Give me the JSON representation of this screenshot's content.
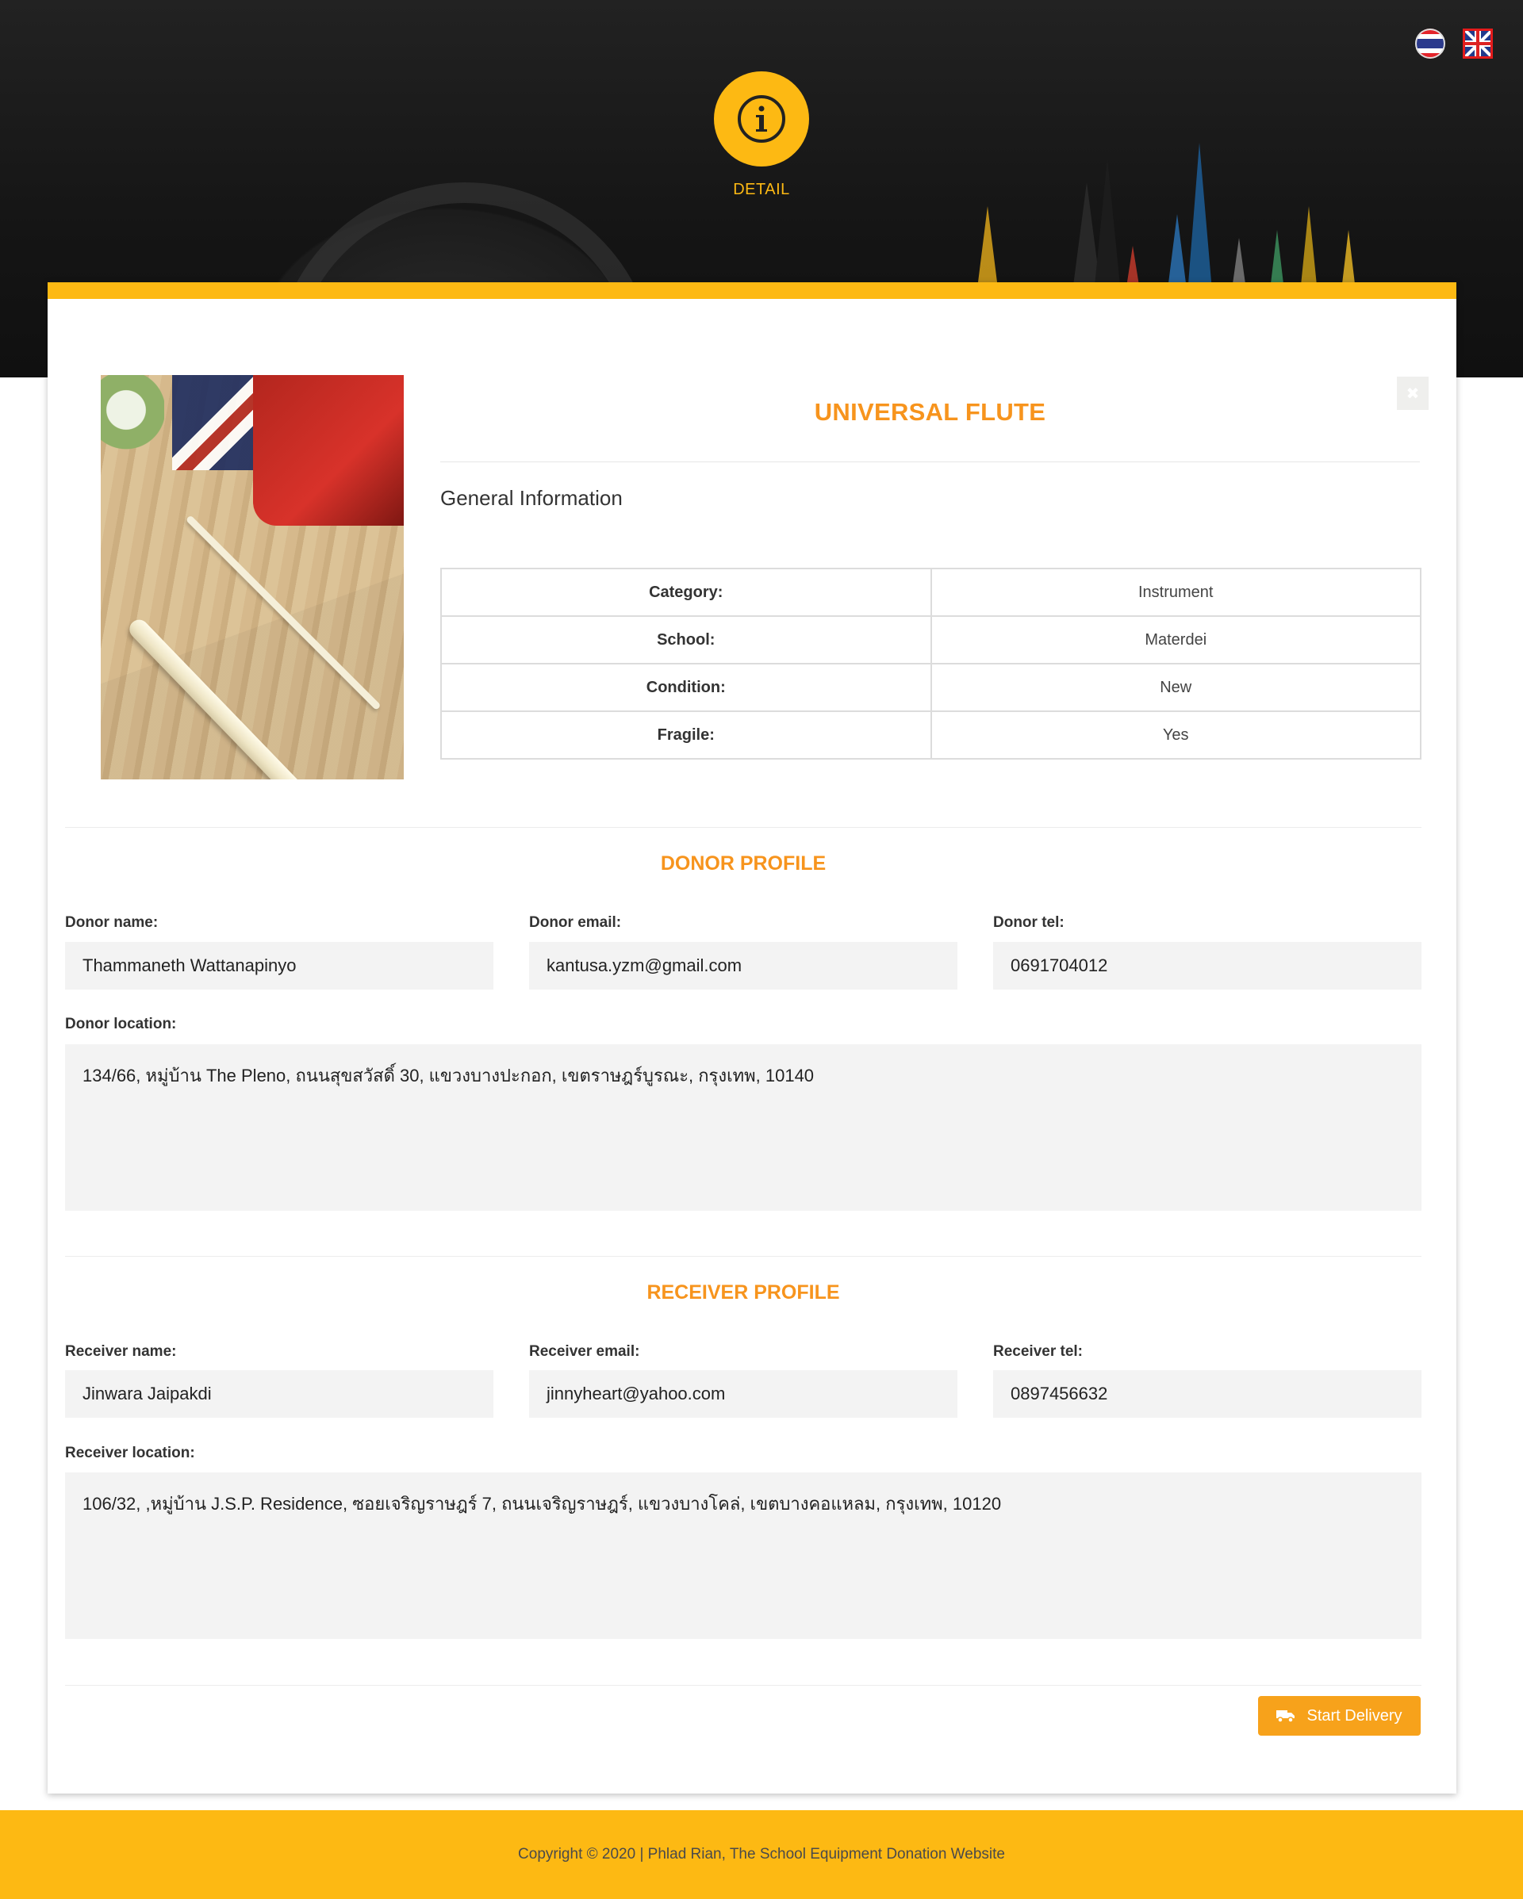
{
  "header": {
    "languages": [
      {
        "code": "th",
        "icon": "thai-flag-icon"
      },
      {
        "code": "en",
        "icon": "uk-flag-icon"
      }
    ],
    "badge_icon": "info-icon",
    "badge_label": "DETAIL"
  },
  "item": {
    "title": "UNIVERSAL FLUTE",
    "section_heading": "General Information",
    "info": [
      {
        "label": "Category:",
        "value": "Instrument"
      },
      {
        "label": "School:",
        "value": "Materdei"
      },
      {
        "label": "Condition:",
        "value": "New"
      },
      {
        "label": "Fragile:",
        "value": "Yes"
      }
    ]
  },
  "donor": {
    "section_title": "DONOR PROFILE",
    "name_label": "Donor name:",
    "name": "Thammaneth Wattanapinyo",
    "email_label": "Donor email:",
    "email": "kantusa.yzm@gmail.com",
    "tel_label": "Donor tel:",
    "tel": "0691704012",
    "location_label": "Donor location:",
    "location": "134/66, หมู่บ้าน The Pleno, ถนนสุขสวัสดิ์ 30, แขวงบางปะกอก, เขตราษฎร์บูรณะ, กรุงเทพ, 10140"
  },
  "receiver": {
    "section_title": "RECEIVER PROFILE",
    "name_label": "Receiver name:",
    "name": "Jinwara Jaipakdi",
    "email_label": "Receiver email:",
    "email": "jinnyheart@yahoo.com",
    "tel_label": "Receiver tel:",
    "tel": "0897456632",
    "location_label": "Receiver location:",
    "location": "106/32, ,หมู่บ้าน J.S.P. Residence, ซอยเจริญราษฎร์ 7, ถนนเจริญราษฎร์, แขวงบางโคล่, เขตบางคอแหลม, กรุงเทพ, 10120"
  },
  "actions": {
    "start_delivery_label": "Start Delivery",
    "start_delivery_icon": "truck-icon",
    "close_icon": "close-icon"
  },
  "footer": {
    "copyright": "Copyright © 2020 | Phlad Rian, The School Equipment Donation Website"
  },
  "colors": {
    "accent": "#fdb913",
    "title_orange": "#f7941d",
    "button": "#f7a21b",
    "field_bg": "#f3f3f3"
  }
}
